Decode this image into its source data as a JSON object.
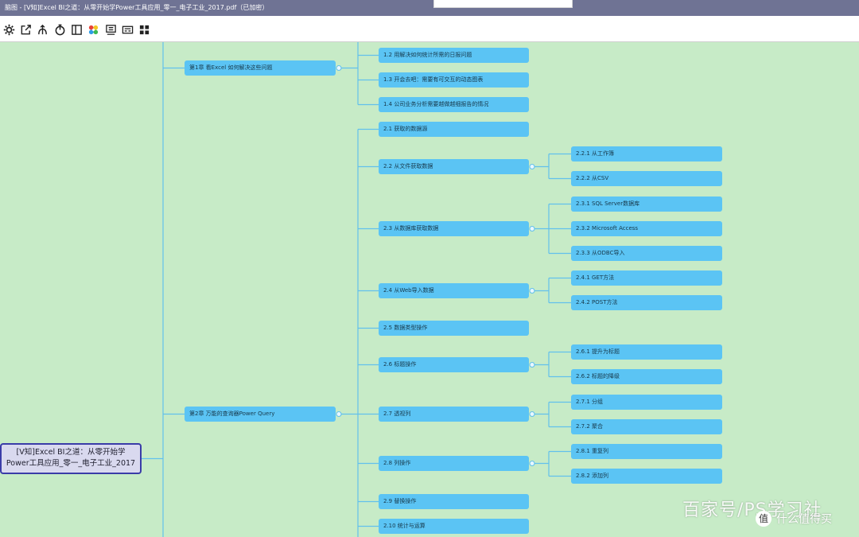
{
  "window": {
    "title": "脑图 - [V知]Excel BI之道：从零开始学Power工具应用_零一_电子工业_2017.pdf（已加密）"
  },
  "toolbar": {
    "icons": [
      "gear-icon",
      "export-icon",
      "branch-icon",
      "timer-icon",
      "split-view-icon",
      "palette-icon",
      "presentation-icon",
      "keyboard-icon",
      "grid-icon"
    ]
  },
  "mindmap": {
    "root": {
      "lines": [
        "[V知]Excel BI之道：从零开始学",
        "Power工具应用_零一_电子工业_2017"
      ]
    },
    "chapters": [
      {
        "label": "第1章 看Excel 如何解决这些问题",
        "sections": [
          {
            "label": "1.2 用解决如何统计所需的日报问题"
          },
          {
            "label": "1.3 开会去吧：需要有可交互的动态图表"
          },
          {
            "label": "1.4 公司业务分析需要越做越细报告的情况"
          }
        ]
      },
      {
        "label": "第2章 万能的查询器Power Query",
        "sections": [
          {
            "label": "2.1 获取的数据源"
          },
          {
            "label": "2.2 从文件获取数据",
            "children": [
              {
                "label": "2.2.1 从工作簿"
              },
              {
                "label": "2.2.2 从CSV"
              }
            ]
          },
          {
            "label": "2.3 从数据库获取数据",
            "children": [
              {
                "label": "2.3.1 SQL Server数据库"
              },
              {
                "label": "2.3.2 Microsoft Access"
              },
              {
                "label": "2.3.3 从ODBC导入"
              }
            ]
          },
          {
            "label": "2.4 从Web导入数据",
            "children": [
              {
                "label": "2.4.1 GET方法"
              },
              {
                "label": "2.4.2 POST方法"
              }
            ]
          },
          {
            "label": "2.5 数据类型操作"
          },
          {
            "label": "2.6 标题操作",
            "children": [
              {
                "label": "2.6.1 提升为标题"
              },
              {
                "label": "2.6.2 标题的降级"
              }
            ]
          },
          {
            "label": "2.7 透视列",
            "children": [
              {
                "label": "2.7.1 分组"
              },
              {
                "label": "2.7.2 聚合"
              }
            ]
          },
          {
            "label": "2.8 列操作",
            "children": [
              {
                "label": "2.8.1 重复列"
              },
              {
                "label": "2.8.2 添加列"
              }
            ]
          },
          {
            "label": "2.9 替换操作"
          },
          {
            "label": "2.10 统计与运算"
          }
        ]
      }
    ]
  },
  "watermarks": {
    "baijiahao": "百家号/PS学习社",
    "smzdm_logo": "值",
    "smzdm": "什么值得买"
  },
  "colors": {
    "titlebar-bg": "#6f7394",
    "canvas-bg": "#c7ebc7",
    "node-fill": "#5bc4f4",
    "root-fill": "#d9d9ef",
    "root-border": "#3a3ca8",
    "line": "#62c0ec"
  }
}
